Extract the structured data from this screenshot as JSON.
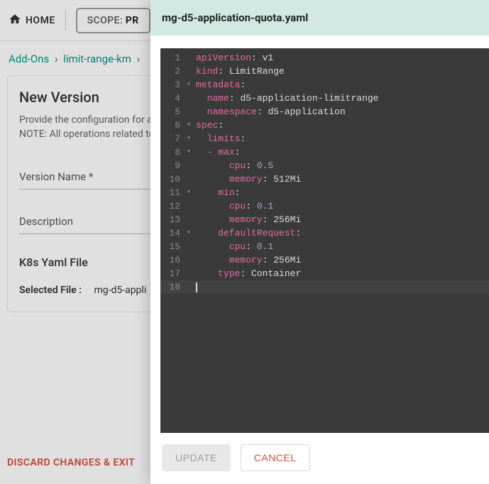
{
  "topbar": {
    "home_label": "HOME",
    "scope_prefix": "SCOPE: ",
    "scope_value": "PR"
  },
  "breadcrumb": {
    "items": [
      "Add-Ons",
      "limit-range-km"
    ]
  },
  "card": {
    "title": "New Version",
    "desc_line1": "Provide the configuration for a",
    "desc_line2": "NOTE: All operations related to",
    "version_label": "Version Name *",
    "description_label": "Description",
    "k8s_title": "K8s Yaml File",
    "selected_file_label": "Selected File :",
    "selected_file_value": "mg-d5-appli"
  },
  "bottom": {
    "discard_label": "DISCARD CHANGES & EXIT"
  },
  "drawer": {
    "filename": "mg-d5-application-quota.yaml",
    "update_label": "UPDATE",
    "cancel_label": "CANCEL"
  },
  "code_lines": [
    [
      [
        "key",
        "apiVersion"
      ],
      [
        "punc",
        ": "
      ],
      [
        "str",
        "v1"
      ]
    ],
    [
      [
        "key",
        "kind"
      ],
      [
        "punc",
        ": "
      ],
      [
        "str",
        "LimitRange"
      ]
    ],
    [
      [
        "key",
        "metadata"
      ],
      [
        "punc",
        ":"
      ]
    ],
    [
      [
        "pad",
        "  "
      ],
      [
        "key",
        "name"
      ],
      [
        "punc",
        ": "
      ],
      [
        "str",
        "d5-application-limitrange"
      ]
    ],
    [
      [
        "pad",
        "  "
      ],
      [
        "key",
        "namespace"
      ],
      [
        "punc",
        ": "
      ],
      [
        "str",
        "d5-application"
      ]
    ],
    [
      [
        "key",
        "spec"
      ],
      [
        "punc",
        ":"
      ]
    ],
    [
      [
        "pad",
        "  "
      ],
      [
        "key",
        "limits"
      ],
      [
        "punc",
        ":"
      ]
    ],
    [
      [
        "pad",
        "  "
      ],
      [
        "dash",
        "- "
      ],
      [
        "key",
        "max"
      ],
      [
        "punc",
        ":"
      ]
    ],
    [
      [
        "pad",
        "      "
      ],
      [
        "key",
        "cpu"
      ],
      [
        "punc",
        ": "
      ],
      [
        "num",
        "0.5"
      ]
    ],
    [
      [
        "pad",
        "      "
      ],
      [
        "key",
        "memory"
      ],
      [
        "punc",
        ": "
      ],
      [
        "str",
        "512Mi"
      ]
    ],
    [
      [
        "pad",
        "    "
      ],
      [
        "key",
        "min"
      ],
      [
        "punc",
        ":"
      ]
    ],
    [
      [
        "pad",
        "      "
      ],
      [
        "key",
        "cpu"
      ],
      [
        "punc",
        ": "
      ],
      [
        "num",
        "0.1"
      ]
    ],
    [
      [
        "pad",
        "      "
      ],
      [
        "key",
        "memory"
      ],
      [
        "punc",
        ": "
      ],
      [
        "str",
        "256Mi"
      ]
    ],
    [
      [
        "pad",
        "    "
      ],
      [
        "key",
        "defaultRequest"
      ],
      [
        "punc",
        ":"
      ]
    ],
    [
      [
        "pad",
        "      "
      ],
      [
        "key",
        "cpu"
      ],
      [
        "punc",
        ": "
      ],
      [
        "num",
        "0.1"
      ]
    ],
    [
      [
        "pad",
        "      "
      ],
      [
        "key",
        "memory"
      ],
      [
        "punc",
        ": "
      ],
      [
        "str",
        "256Mi"
      ]
    ],
    [
      [
        "pad",
        "    "
      ],
      [
        "key",
        "type"
      ],
      [
        "punc",
        ": "
      ],
      [
        "str",
        "Container"
      ]
    ],
    []
  ],
  "fold_rows": [
    3,
    6,
    7,
    8,
    11,
    14
  ]
}
